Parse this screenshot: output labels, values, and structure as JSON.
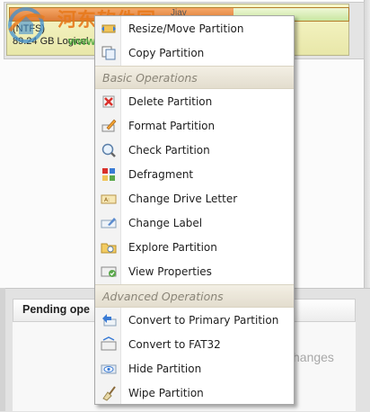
{
  "partition": {
    "name": "(NTFS)",
    "size": "89.24 GB Logical",
    "bar_text": "Jiav",
    "used_fraction": 0.66
  },
  "watermark": {
    "title": "河东软件园",
    "url": "www.pc0359.cn"
  },
  "pending_panel": {
    "title": "Pending ope",
    "changes_text": "hanges"
  },
  "context_menu": {
    "top_items": [
      {
        "label": "Resize/Move Partition",
        "icon": "resize-icon"
      },
      {
        "label": "Copy Partition",
        "icon": "copy-icon"
      }
    ],
    "basic_header": "Basic Operations",
    "basic_items": [
      {
        "label": "Delete Partition",
        "icon": "delete-icon"
      },
      {
        "label": "Format Partition",
        "icon": "format-icon"
      },
      {
        "label": "Check Partition",
        "icon": "check-icon"
      },
      {
        "label": "Defragment",
        "icon": "defragment-icon"
      },
      {
        "label": "Change Drive Letter",
        "icon": "drive-letter-icon"
      },
      {
        "label": "Change Label",
        "icon": "label-icon"
      },
      {
        "label": "Explore Partition",
        "icon": "explore-icon"
      },
      {
        "label": "View Properties",
        "icon": "properties-icon"
      }
    ],
    "advanced_header": "Advanced Operations",
    "advanced_items": [
      {
        "label": "Convert to Primary Partition",
        "icon": "convert-primary-icon"
      },
      {
        "label": "Convert to FAT32",
        "icon": "convert-fat32-icon"
      },
      {
        "label": "Hide Partition",
        "icon": "hide-icon"
      },
      {
        "label": "Wipe Partition",
        "icon": "wipe-icon"
      }
    ]
  },
  "colors": {
    "menu_header_text": "#8a8578",
    "watermark_orange": "#e8791a",
    "watermark_green": "#4aa83c",
    "partition_used": "#e08a45",
    "partition_free": "#c8e6a0"
  }
}
